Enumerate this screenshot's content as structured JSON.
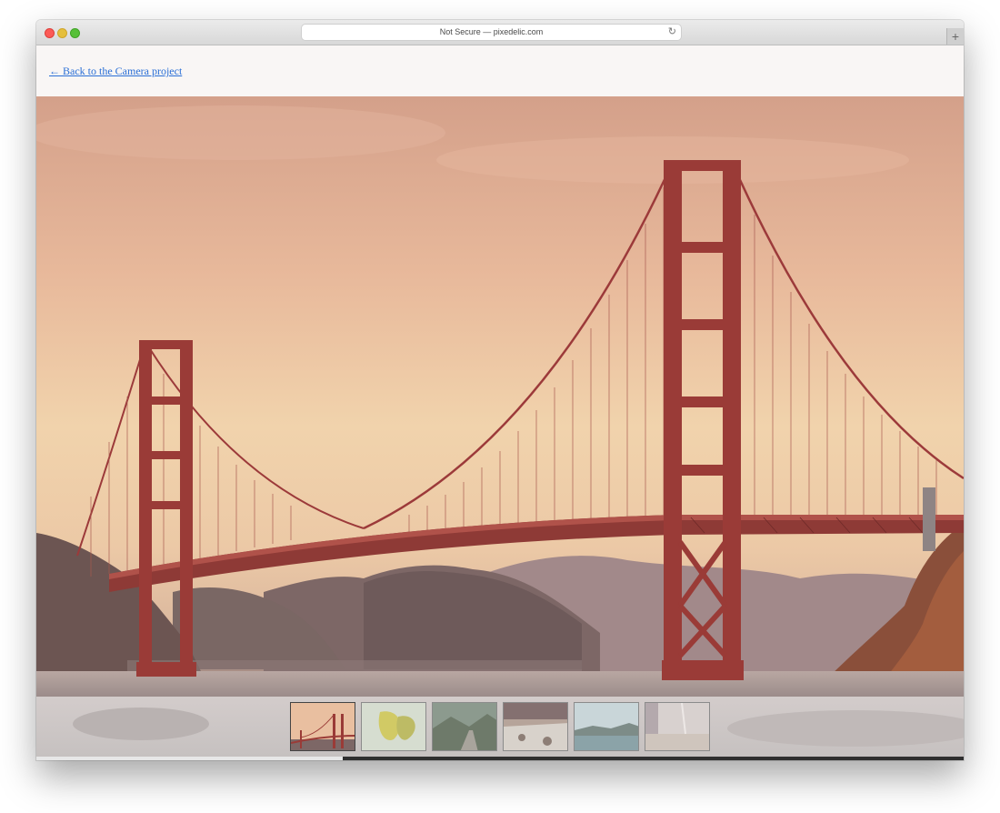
{
  "browser": {
    "address": "Not Secure — pixedelic.com",
    "reload_icon": "reload-icon",
    "new_tab_icon": "plus-icon"
  },
  "header": {
    "back_link": "← Back to the Camera project"
  },
  "slideshow": {
    "current_slide": 1,
    "slide_count": 6,
    "progress": 0.33,
    "thumbnails": [
      {
        "name": "thumb-golden-gate-bridge"
      },
      {
        "name": "thumb-yellow-leaves"
      },
      {
        "name": "thumb-mountain-road"
      },
      {
        "name": "thumb-rocky-coast"
      },
      {
        "name": "thumb-lake-shore"
      },
      {
        "name": "thumb-misty-field"
      }
    ]
  },
  "colors": {
    "link": "#2a6fd6",
    "bridge": "#9c3a3a",
    "sky_warm": "#f0cfa8"
  }
}
